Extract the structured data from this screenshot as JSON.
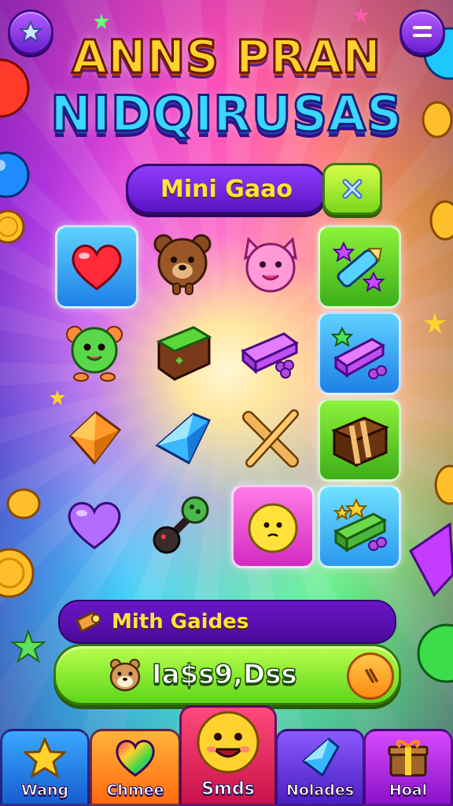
{
  "header": {
    "title_line1": "ANNS PRAN",
    "title_line2": "NIDQIRUSAS"
  },
  "mode": {
    "label": "Mini Gaao"
  },
  "hint": {
    "label": "Mith Gaides"
  },
  "score": {
    "value": "Ia$s9,Dss"
  },
  "tabs": [
    {
      "label": "Wang"
    },
    {
      "label": "Chmee"
    },
    {
      "label": "Smds"
    },
    {
      "label": "Nolades"
    },
    {
      "label": "Hoal"
    }
  ],
  "colors": {
    "title_top": "#ffd22e",
    "title_bottom": "#3ad7ff",
    "panel_purple": "#6a16c8",
    "accent_green": "#7bd61c",
    "accent_yellow": "#ffe23a"
  }
}
